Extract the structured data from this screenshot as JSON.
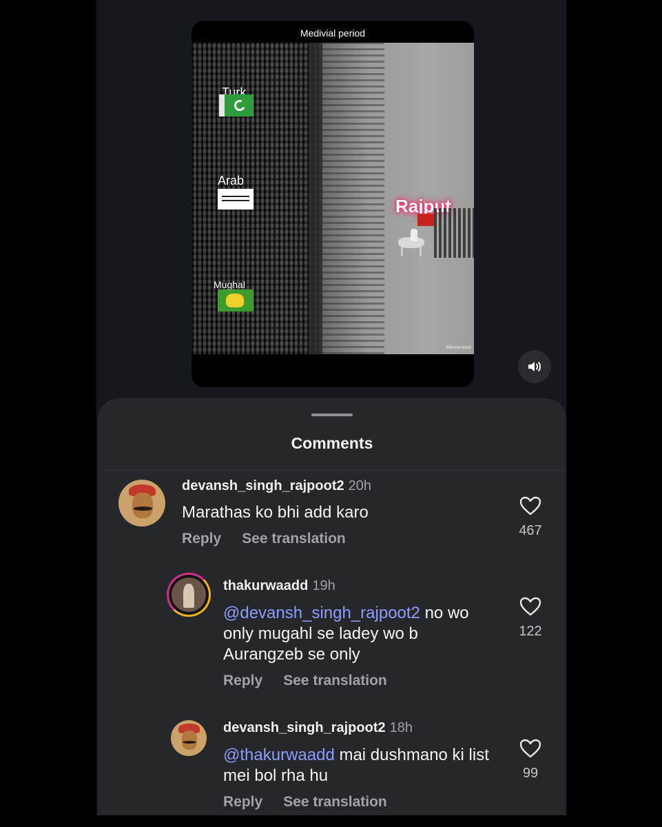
{
  "video": {
    "title": "Medivial period",
    "labels": {
      "turk": "Turk",
      "arab": "Arab",
      "mughal": "Mughal",
      "rajput": "Rajput"
    },
    "watermark": "Mewarrayat"
  },
  "comments_sheet": {
    "title": "Comments",
    "comments": [
      {
        "username": "devansh_singh_rajpoot2",
        "time": "20h",
        "text": "Marathas ko bhi add karo",
        "reply_label": "Reply",
        "translate_label": "See translation",
        "likes": "467"
      },
      {
        "username": "thakurwaadd",
        "time": "19h",
        "mention": "@devansh_singh_rajpoot2",
        "text": " no wo only mugahl se ladey wo b Aurangzeb se only",
        "reply_label": "Reply",
        "translate_label": "See translation",
        "likes": "122"
      },
      {
        "username": "devansh_singh_rajpoot2",
        "time": "18h",
        "mention": "@thakurwaadd",
        "text": " mai dushmano ki list mei bol rha hu",
        "reply_label": "Reply",
        "translate_label": "See translation",
        "likes": "99"
      }
    ]
  },
  "colors": {
    "background": "#15181c",
    "sheet": "#25272b",
    "mention": "#8e9bff",
    "rajput_glow": "#ff2b6b"
  },
  "icons": {
    "sound": "speaker-icon",
    "like": "heart-icon"
  }
}
